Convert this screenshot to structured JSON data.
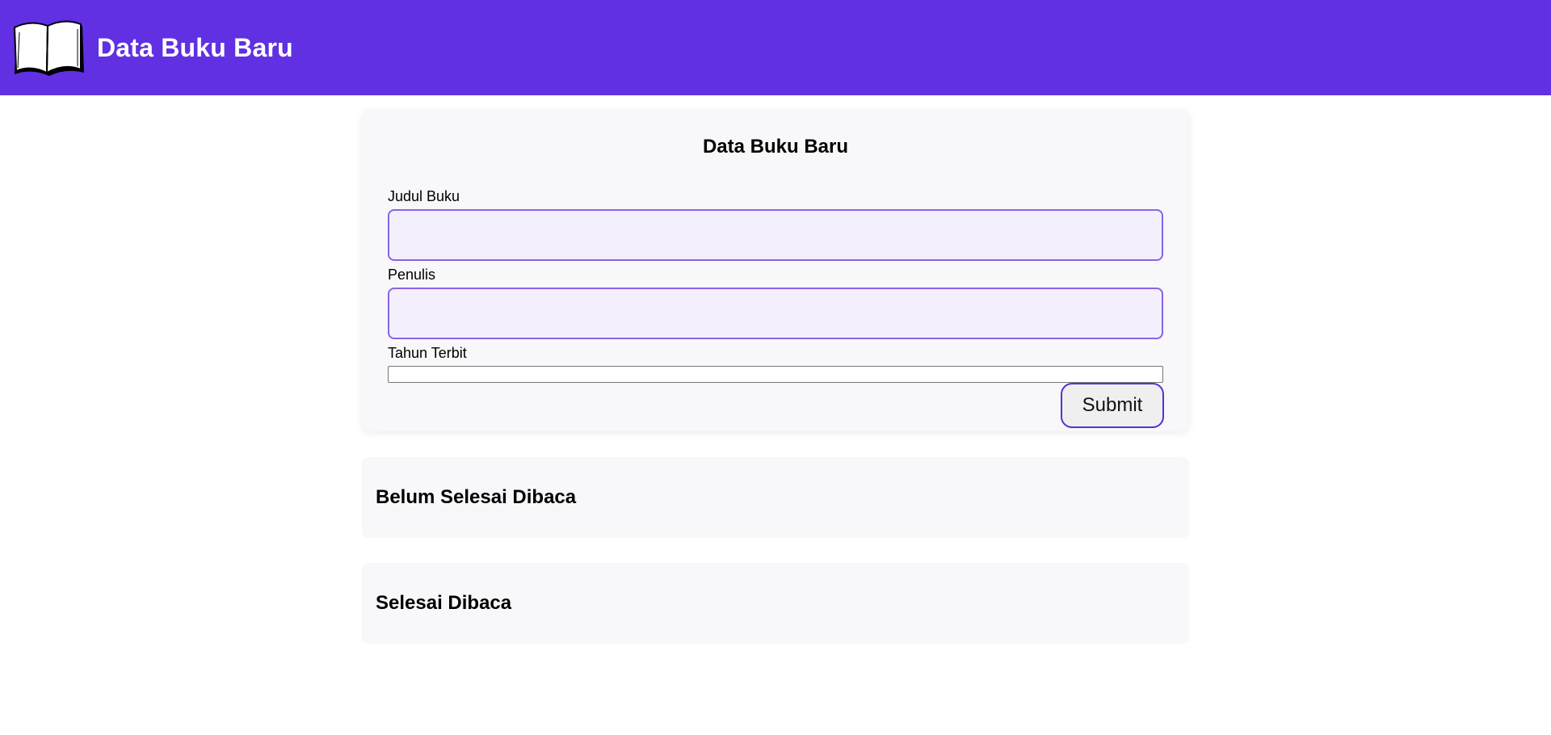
{
  "header": {
    "title": "Data Buku Baru",
    "logo_icon": "open-book-icon",
    "background": "#6030e2"
  },
  "form": {
    "title": "Data Buku Baru",
    "fields": [
      {
        "label": "Judul Buku",
        "value": "",
        "type": "text"
      },
      {
        "label": "Penulis",
        "value": "",
        "type": "text"
      },
      {
        "label": "Tahun Terbit",
        "value": "",
        "type": "number"
      }
    ],
    "submit_label": "Submit",
    "accent": "#6030e2"
  },
  "shelves": {
    "incomplete_title": "Belum Selesai Dibaca",
    "complete_title": "Selesai Dibaca"
  }
}
